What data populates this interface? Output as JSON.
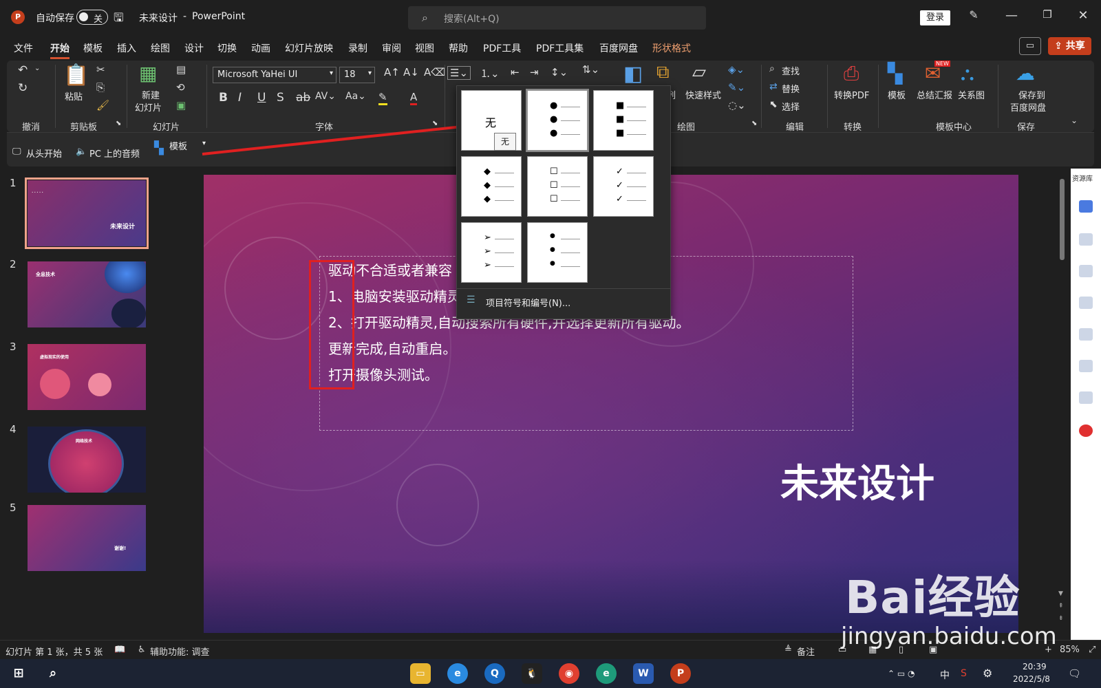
{
  "titlebar": {
    "app_icon_letter": "P",
    "autosave_label": "自动保存",
    "autosave_state": "关",
    "doc_title": "未来设计",
    "separator": "-",
    "app_name": "PowerPoint",
    "search_placeholder": "搜索(Alt+Q)",
    "login_label": "登录"
  },
  "menubar": {
    "items": [
      "文件",
      "开始",
      "模板",
      "插入",
      "绘图",
      "设计",
      "切换",
      "动画",
      "幻灯片放映",
      "录制",
      "审阅",
      "视图",
      "帮助",
      "PDF工具",
      "PDF工具集",
      "百度网盘",
      "形状格式"
    ],
    "active": "开始",
    "share_label": "共享"
  },
  "ribbon": {
    "groups": {
      "undo": "撤消",
      "clipboard": "剪贴板",
      "slides": "幻灯片",
      "font": "字体",
      "drawing": "绘图",
      "editing": "编辑",
      "convert": "转换",
      "template_center": "模板中心",
      "save": "保存"
    },
    "paste": "粘贴",
    "new_slide_line1": "新建",
    "new_slide_line2": "幻灯片",
    "font_name": "Microsoft YaHei UI",
    "font_size": "18",
    "arrange": "排列",
    "quick_styles": "快速样式",
    "find": "查找",
    "replace": "替换",
    "select": "选择",
    "to_pdf": "转换PDF",
    "template": "模板",
    "summary": "总结汇报",
    "relation": "关系图",
    "save_to_line1": "保存到",
    "save_to_line2": "百度网盘",
    "new_badge": "NEW"
  },
  "qat": {
    "from_start": "从头开始",
    "pc_audio": "PC 上的音频",
    "template": "模板"
  },
  "dropdown": {
    "none_label": "无",
    "tooltip": "无",
    "bullets_numbering": "项目符号和编号(N)..."
  },
  "slides": [
    {
      "num": "1",
      "title": "未来设计"
    },
    {
      "num": "2",
      "title": "全息技术"
    },
    {
      "num": "3",
      "title": "虚拟现实的使用"
    },
    {
      "num": "4",
      "title": "网络技术"
    },
    {
      "num": "5",
      "title": "谢谢!"
    }
  ],
  "slide": {
    "lines": [
      "驱动不合适或者兼容",
      "1、电脑安装驱动精灵",
      "2、打开驱动精灵,自动搜索所有硬件,并选择更新所有驱动。",
      "更新完成,自动重启。",
      "打开摄像头测试。"
    ],
    "title": "未来设计"
  },
  "rightrail": {
    "label": "资源库"
  },
  "statusbar": {
    "slide_info": "幻灯片 第 1 张，共 5 张",
    "accessibility": "辅助功能: 调查",
    "notes": "备注",
    "zoom": "85%"
  },
  "taskbar": {
    "ime": "中",
    "time": "20:39",
    "date": "2022/5/8"
  },
  "watermark": {
    "brand": "Bai经验",
    "url": "jingyan.baidu.com"
  },
  "colors": {
    "accent": "#c43e1c",
    "highlight_box": "#e02020",
    "arrow": "#e02020"
  }
}
